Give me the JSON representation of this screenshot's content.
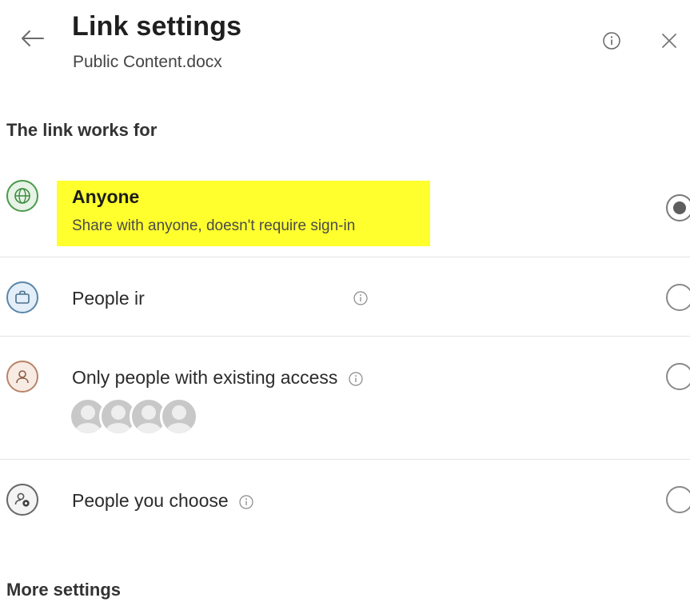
{
  "header": {
    "title": "Link settings",
    "subtitle": "Public Content.docx"
  },
  "section_link_works_for": {
    "label": "The link works for"
  },
  "options": [
    {
      "label": "Anyone",
      "description": "Share with anyone, doesn't require sign-in",
      "icon": "globe-icon",
      "selected": true,
      "highlight_color": "#ffff2e"
    },
    {
      "label": "People ir",
      "icon": "briefcase-icon",
      "selected": false
    },
    {
      "label": "Only people with existing access",
      "icon": "person-icon",
      "selected": false,
      "avatar_count": 4
    },
    {
      "label": "People you choose",
      "icon": "person-gear-icon",
      "selected": false
    }
  ],
  "section_more_settings": {
    "label": "More settings"
  },
  "colors": {
    "anyone_icon_bg": "#e6f3e6",
    "anyone_icon_fg": "#3d8b3d",
    "org_icon_bg": "#e3eef8",
    "org_icon_fg": "#4a6f8e",
    "existing_icon_bg": "#f8ebe3",
    "existing_icon_fg": "#8c5e48",
    "choose_icon_fg": "#555555"
  }
}
